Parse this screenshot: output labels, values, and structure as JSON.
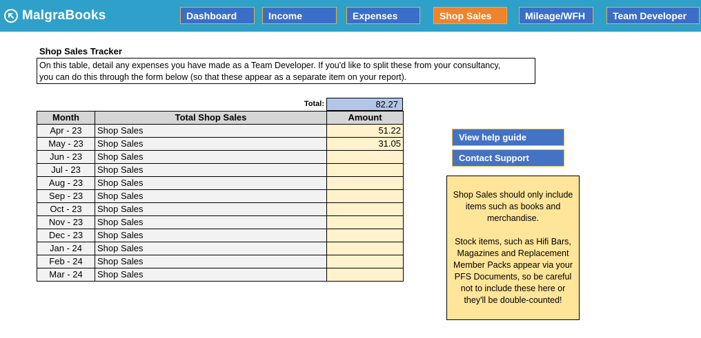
{
  "app": {
    "brand": "MalgraBooks",
    "brand_icon": "arrow-circle-icon",
    "colors": {
      "topbar": "#2fa0c9",
      "nav": "#3b6fc7",
      "nav_active": "#f0832b",
      "nav_border": "#e9b23a"
    }
  },
  "nav": {
    "dashboard": "Dashboard",
    "income": "Income",
    "expenses": "Expenses",
    "shop_sales": "Shop Sales",
    "mileage": "Mileage/WFH",
    "team_developer": "Team Developer",
    "active": "Shop Sales"
  },
  "page": {
    "title": "Shop Sales Tracker",
    "description_line1": "On this table, detail any expenses you have made as a Team Developer. If you'd like to split these from your consultancy,",
    "description_line2": "you can do this through the form below (so that these appear as a separate item on your report)."
  },
  "total": {
    "label": "Total:",
    "value": "82.27"
  },
  "table": {
    "headers": {
      "month": "Month",
      "type": "Total Shop Sales",
      "amount": "Amount"
    },
    "rows": [
      {
        "month": "Apr - 23",
        "type": "Shop Sales",
        "amount": "51.22"
      },
      {
        "month": "May - 23",
        "type": "Shop Sales",
        "amount": "31.05"
      },
      {
        "month": "Jun - 23",
        "type": "Shop Sales",
        "amount": ""
      },
      {
        "month": "Jul - 23",
        "type": "Shop Sales",
        "amount": ""
      },
      {
        "month": "Aug - 23",
        "type": "Shop Sales",
        "amount": ""
      },
      {
        "month": "Sep - 23",
        "type": "Shop Sales",
        "amount": ""
      },
      {
        "month": "Oct - 23",
        "type": "Shop Sales",
        "amount": ""
      },
      {
        "month": "Nov - 23",
        "type": "Shop Sales",
        "amount": ""
      },
      {
        "month": "Dec - 23",
        "type": "Shop Sales",
        "amount": ""
      },
      {
        "month": "Jan - 24",
        "type": "Shop Sales",
        "amount": ""
      },
      {
        "month": "Feb - 24",
        "type": "Shop Sales",
        "amount": ""
      },
      {
        "month": "Mar - 24",
        "type": "Shop Sales",
        "amount": ""
      }
    ]
  },
  "side": {
    "help_button": "View help guide",
    "support_button": "Contact Support",
    "note_para1": "Shop Sales should only include items such as books and merchandise.",
    "note_para2": "Stock items, such as Hifi Bars, Magazines and Replacement Member Packs appear via your PFS Documents, so be careful not to include these here or they'll be double-counted!"
  }
}
